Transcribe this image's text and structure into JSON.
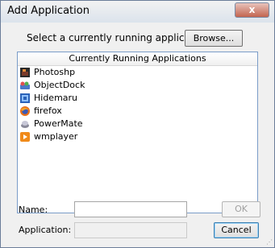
{
  "window": {
    "title": "Add Application",
    "close_label": "x"
  },
  "prompt_label": "Select a currently running application",
  "browse_label": "Browse...",
  "list": {
    "header": "Currently Running Applications",
    "items": [
      {
        "label": "Photoshp",
        "icon": "photoshop-icon"
      },
      {
        "label": "ObjectDock",
        "icon": "objectdock-icon"
      },
      {
        "label": "Hidemaru",
        "icon": "hidemaru-icon"
      },
      {
        "label": "firefox",
        "icon": "firefox-icon"
      },
      {
        "label": "PowerMate",
        "icon": "powermate-icon"
      },
      {
        "label": "wmplayer",
        "icon": "wmplayer-icon"
      }
    ]
  },
  "name_label": "Name:",
  "name_value": "",
  "ok_label": "OK",
  "application_label": "Application:",
  "application_value": "",
  "cancel_label": "Cancel"
}
